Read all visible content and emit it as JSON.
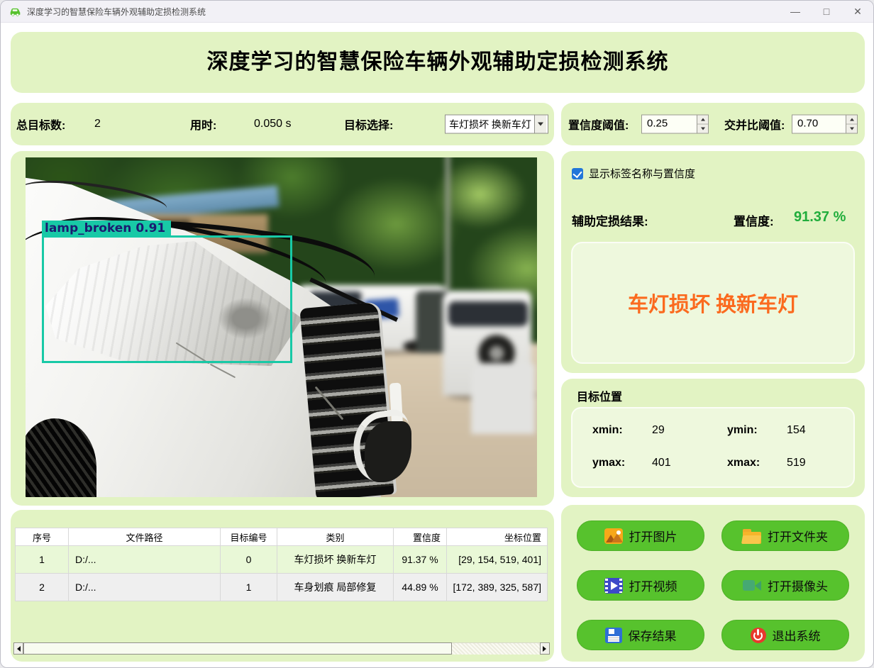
{
  "window": {
    "title": "深度学习的智慧保险车辆外观辅助定损检测系统"
  },
  "icons": {
    "app-icon": "green-car",
    "minimize-icon": "—",
    "maximize-icon": "□",
    "close-icon": "✕",
    "dropdown-arrow-icon": "triangle-down",
    "spinner-up-icon": "triangle-up",
    "spinner-down-icon": "triangle-down",
    "checkbox-check-icon": "check",
    "open-image-icon": "picture",
    "open-folder-icon": "folder",
    "open-video-icon": "film-play",
    "open-camera-icon": "camcorder",
    "save-icon": "floppy-disk",
    "exit-icon": "power",
    "scroll-left-icon": "triangle-left",
    "scroll-right-icon": "triangle-right"
  },
  "colors": {
    "panel_green": "#e2f3c3",
    "inner_green": "#eef8dd",
    "button_green": "#57c22d",
    "accent_orange": "#fb6a1e",
    "confidence_green": "#21ad3c",
    "detection_teal": "#18c9a6",
    "checkbox_blue": "#2176d9"
  },
  "header": {
    "title": "深度学习的智慧保险车辆外观辅助定损检测系统"
  },
  "stats": {
    "total_label": "总目标数:",
    "total_value": "2",
    "time_label": "用时:",
    "time_value": "0.050 s",
    "target_select_label": "目标选择:",
    "target_select_value": "车灯损坏 换新车灯",
    "conf_threshold_label": "置信度阈值:",
    "conf_threshold_value": "0.25",
    "iou_threshold_label": "交并比阈值:",
    "iou_threshold_value": "0.70"
  },
  "viewer": {
    "detection_label": "lamp_broken 0.91"
  },
  "result_panel": {
    "show_labels_checkbox": "显示标签名称与置信度",
    "result_label": "辅助定损结果:",
    "confidence_label": "置信度:",
    "confidence_value": "91.37 %",
    "result_text": "车灯损坏 换新车灯"
  },
  "position_panel": {
    "title": "目标位置",
    "xmin_label": "xmin:",
    "xmin_value": "29",
    "ymin_label": "ymin:",
    "ymin_value": "154",
    "ymax_label": "ymax:",
    "ymax_value": "401",
    "xmax_label": "xmax:",
    "xmax_value": "519"
  },
  "buttons": {
    "open_image": "打开图片",
    "open_folder": "打开文件夹",
    "open_video": "打开视频",
    "open_camera": "打开摄像头",
    "save_results": "保存结果",
    "exit_system": "退出系统"
  },
  "table": {
    "headers": [
      "序号",
      "文件路径",
      "目标编号",
      "类别",
      "置信度",
      "坐标位置"
    ],
    "rows": [
      [
        "1",
        "D:/...",
        "0",
        "车灯损坏 换新车灯",
        "91.37 %",
        "[29, 154, 519, 401]"
      ],
      [
        "2",
        "D:/...",
        "1",
        "车身划痕 局部修复",
        "44.89 %",
        "[172, 389, 325, 587]"
      ]
    ]
  }
}
